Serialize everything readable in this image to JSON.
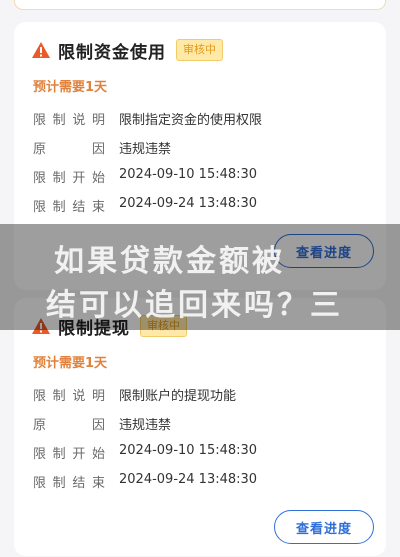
{
  "cards": [
    {
      "title": "限制资金使用",
      "status": "审核中",
      "estimate": "预计需要1天",
      "rows": [
        {
          "label": [
            "限",
            "制",
            "说",
            "明"
          ],
          "value": "限制指定资金的使用权限"
        },
        {
          "label": [
            "原",
            "因"
          ],
          "value": "违规违禁"
        },
        {
          "label": [
            "限",
            "制",
            "开",
            "始"
          ],
          "value": "2024-09-10 15:48:30"
        },
        {
          "label": [
            "限",
            "制",
            "结",
            "束"
          ],
          "value": "2024-09-24 13:48:30"
        }
      ],
      "button": "查看进度"
    },
    {
      "title": "限制提现",
      "status": "审核中",
      "estimate": "预计需要1天",
      "rows": [
        {
          "label": [
            "限",
            "制",
            "说",
            "明"
          ],
          "value": "限制账户的提现功能"
        },
        {
          "label": [
            "原",
            "因"
          ],
          "value": "违规违禁"
        },
        {
          "label": [
            "限",
            "制",
            "开",
            "始"
          ],
          "value": "2024-09-10 15:48:30"
        },
        {
          "label": [
            "限",
            "制",
            "结",
            "束"
          ],
          "value": "2024-09-24 13:48:30"
        }
      ],
      "button": "查看进度"
    }
  ],
  "overlay": {
    "line1": "如果贷款金额被",
    "line2": "结可以追回来吗？三"
  },
  "colors": {
    "accent": "#2f6fd8",
    "warning": "#e85a2a",
    "estimate": "#e0823d",
    "badge_bg": "#ffe9a8"
  },
  "icons": {
    "warning": "warning-triangle-icon"
  }
}
